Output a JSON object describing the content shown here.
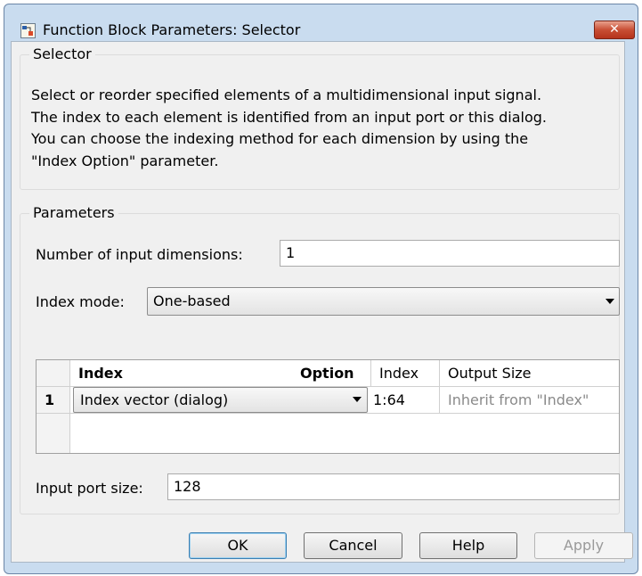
{
  "window": {
    "title": "Function Block Parameters: Selector",
    "close_label": "✕"
  },
  "selector_group": {
    "title": "Selector",
    "description_lines": [
      "Select or reorder specified elements of a multidimensional input signal.",
      "The index to each element is identified from an input port or this dialog.",
      "You can choose the indexing method for each dimension by using the",
      "\"Index Option\" parameter."
    ]
  },
  "parameters_group": {
    "title": "Parameters",
    "num_dims_label": "Number of input dimensions:",
    "num_dims_value": "1",
    "index_mode_label": "Index mode:",
    "index_mode_value": "One-based",
    "table": {
      "columns": [
        "Index",
        "Option",
        "Index",
        "Output Size"
      ],
      "rows": [
        {
          "num": "1",
          "option": "Index vector (dialog)",
          "index": "1:64",
          "output_size": "Inherit from \"Index\""
        }
      ]
    },
    "input_port_size_label": "Input port size:",
    "input_port_size_value": "128"
  },
  "buttons": {
    "ok": "OK",
    "cancel": "Cancel",
    "help": "Help",
    "apply": "Apply"
  },
  "colors": {
    "title_bar": "#c9dcef",
    "close_button": "#c84e34",
    "client_bg": "#f0f0f0"
  }
}
